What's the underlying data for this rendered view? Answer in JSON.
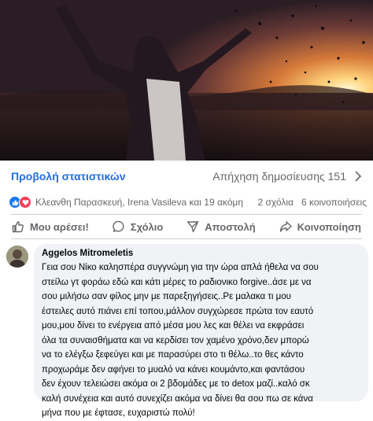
{
  "post": {
    "image_alt_icon": "photo-woman-sunset",
    "stats_link": "Προβολή στατιστικών",
    "reach_label": "Απήχηση δημοσίευσης 151",
    "reactions": {
      "icons": [
        "like-icon",
        "love-icon"
      ],
      "names": "Κλεανθη Παρασκευή, Irena Vasileva και 19 ακόμη",
      "comments": "2 σχόλια",
      "shares": "6 κοινοποιήσεις"
    },
    "actions": {
      "like": "Μου αρέσει!",
      "comment": "Σχόλιο",
      "send": "Αποστολή",
      "share": "Κοινοποίηση"
    }
  },
  "comment": {
    "author": "Aggelos Mitromeletis",
    "text": "Γεια σου Νίκο καλησπέρα συγγνώμη για την ώρα απλά ήθελα να σου\nστείλω γτ φοράω εδώ και κάτι μέρες το ραδιονικο forgive..άσε με να\nσου μιλήσω σαν φίλος μην με παρεξηγήσεις..Ρε μαλακα τι μου\nέστειλες αυτό πιάνει επί τοπου,μάλλον συγχώρεσε πρώτα τον εαυτό\nμου,μου δίνει το ενέργεια από μέσα μου λες και θέλει να εκφράσει\nόλα τα συναισθήματα και να κερδίσει τον χαμένο χρόνο,δεν μπορώ\nνα το ελέγξω ξεφεύγει και με παρασύρει στο τι θέλω..το θες κάντο\nπροχωράμε δεν αφήνει το μυαλό να κάνει κουμάντο,και φαντάσου\nδεν έχουν τελειώσει ακόμα οι 2 βδομάδες με το detox μαζί..καλό σκ\nκαλή συνέχεια και αυτό συνεχίζει ακόμα να δίνει θα σου πω σε κάνα\nμήνα που με έφτασε, ευχαριστώ πολύ!"
  },
  "colors": {
    "link_blue": "#216fdb",
    "secondary_text": "#65676b",
    "bubble_bg": "#f0f2f5",
    "like_blue": "#1877f2",
    "love_red": "#f33e58"
  }
}
